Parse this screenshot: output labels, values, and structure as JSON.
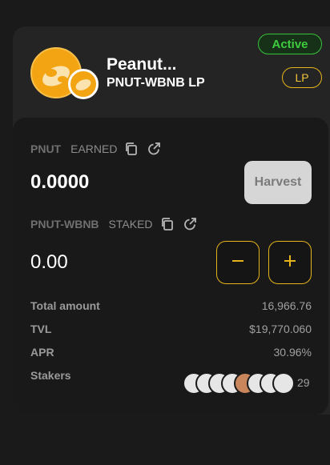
{
  "farm": {
    "name": "Peanut...",
    "pair": "PNUT-WBNB LP",
    "status": "Active",
    "type_badge": "LP"
  },
  "earned": {
    "token": "PNUT",
    "label": "EARNED",
    "amount": "0.0000",
    "harvest_label": "Harvest"
  },
  "staked": {
    "token": "PNUT-WBNB",
    "label": "STAKED",
    "amount": "0.00"
  },
  "stats": {
    "total_amount_label": "Total amount",
    "total_amount_value": "16,966.76",
    "tvl_label": "TVL",
    "tvl_value": "$19,770.060",
    "apr_label": "APR",
    "apr_value": "30.96%",
    "stakers_label": "Stakers",
    "stakers_count": "29"
  },
  "colors": {
    "accent": "#e5b31b",
    "active": "#3fcc3f",
    "card_bg": "#242425",
    "panel_bg": "#191919"
  },
  "icons": [
    "copy-icon",
    "external-link-icon",
    "minus-icon",
    "plus-icon"
  ]
}
